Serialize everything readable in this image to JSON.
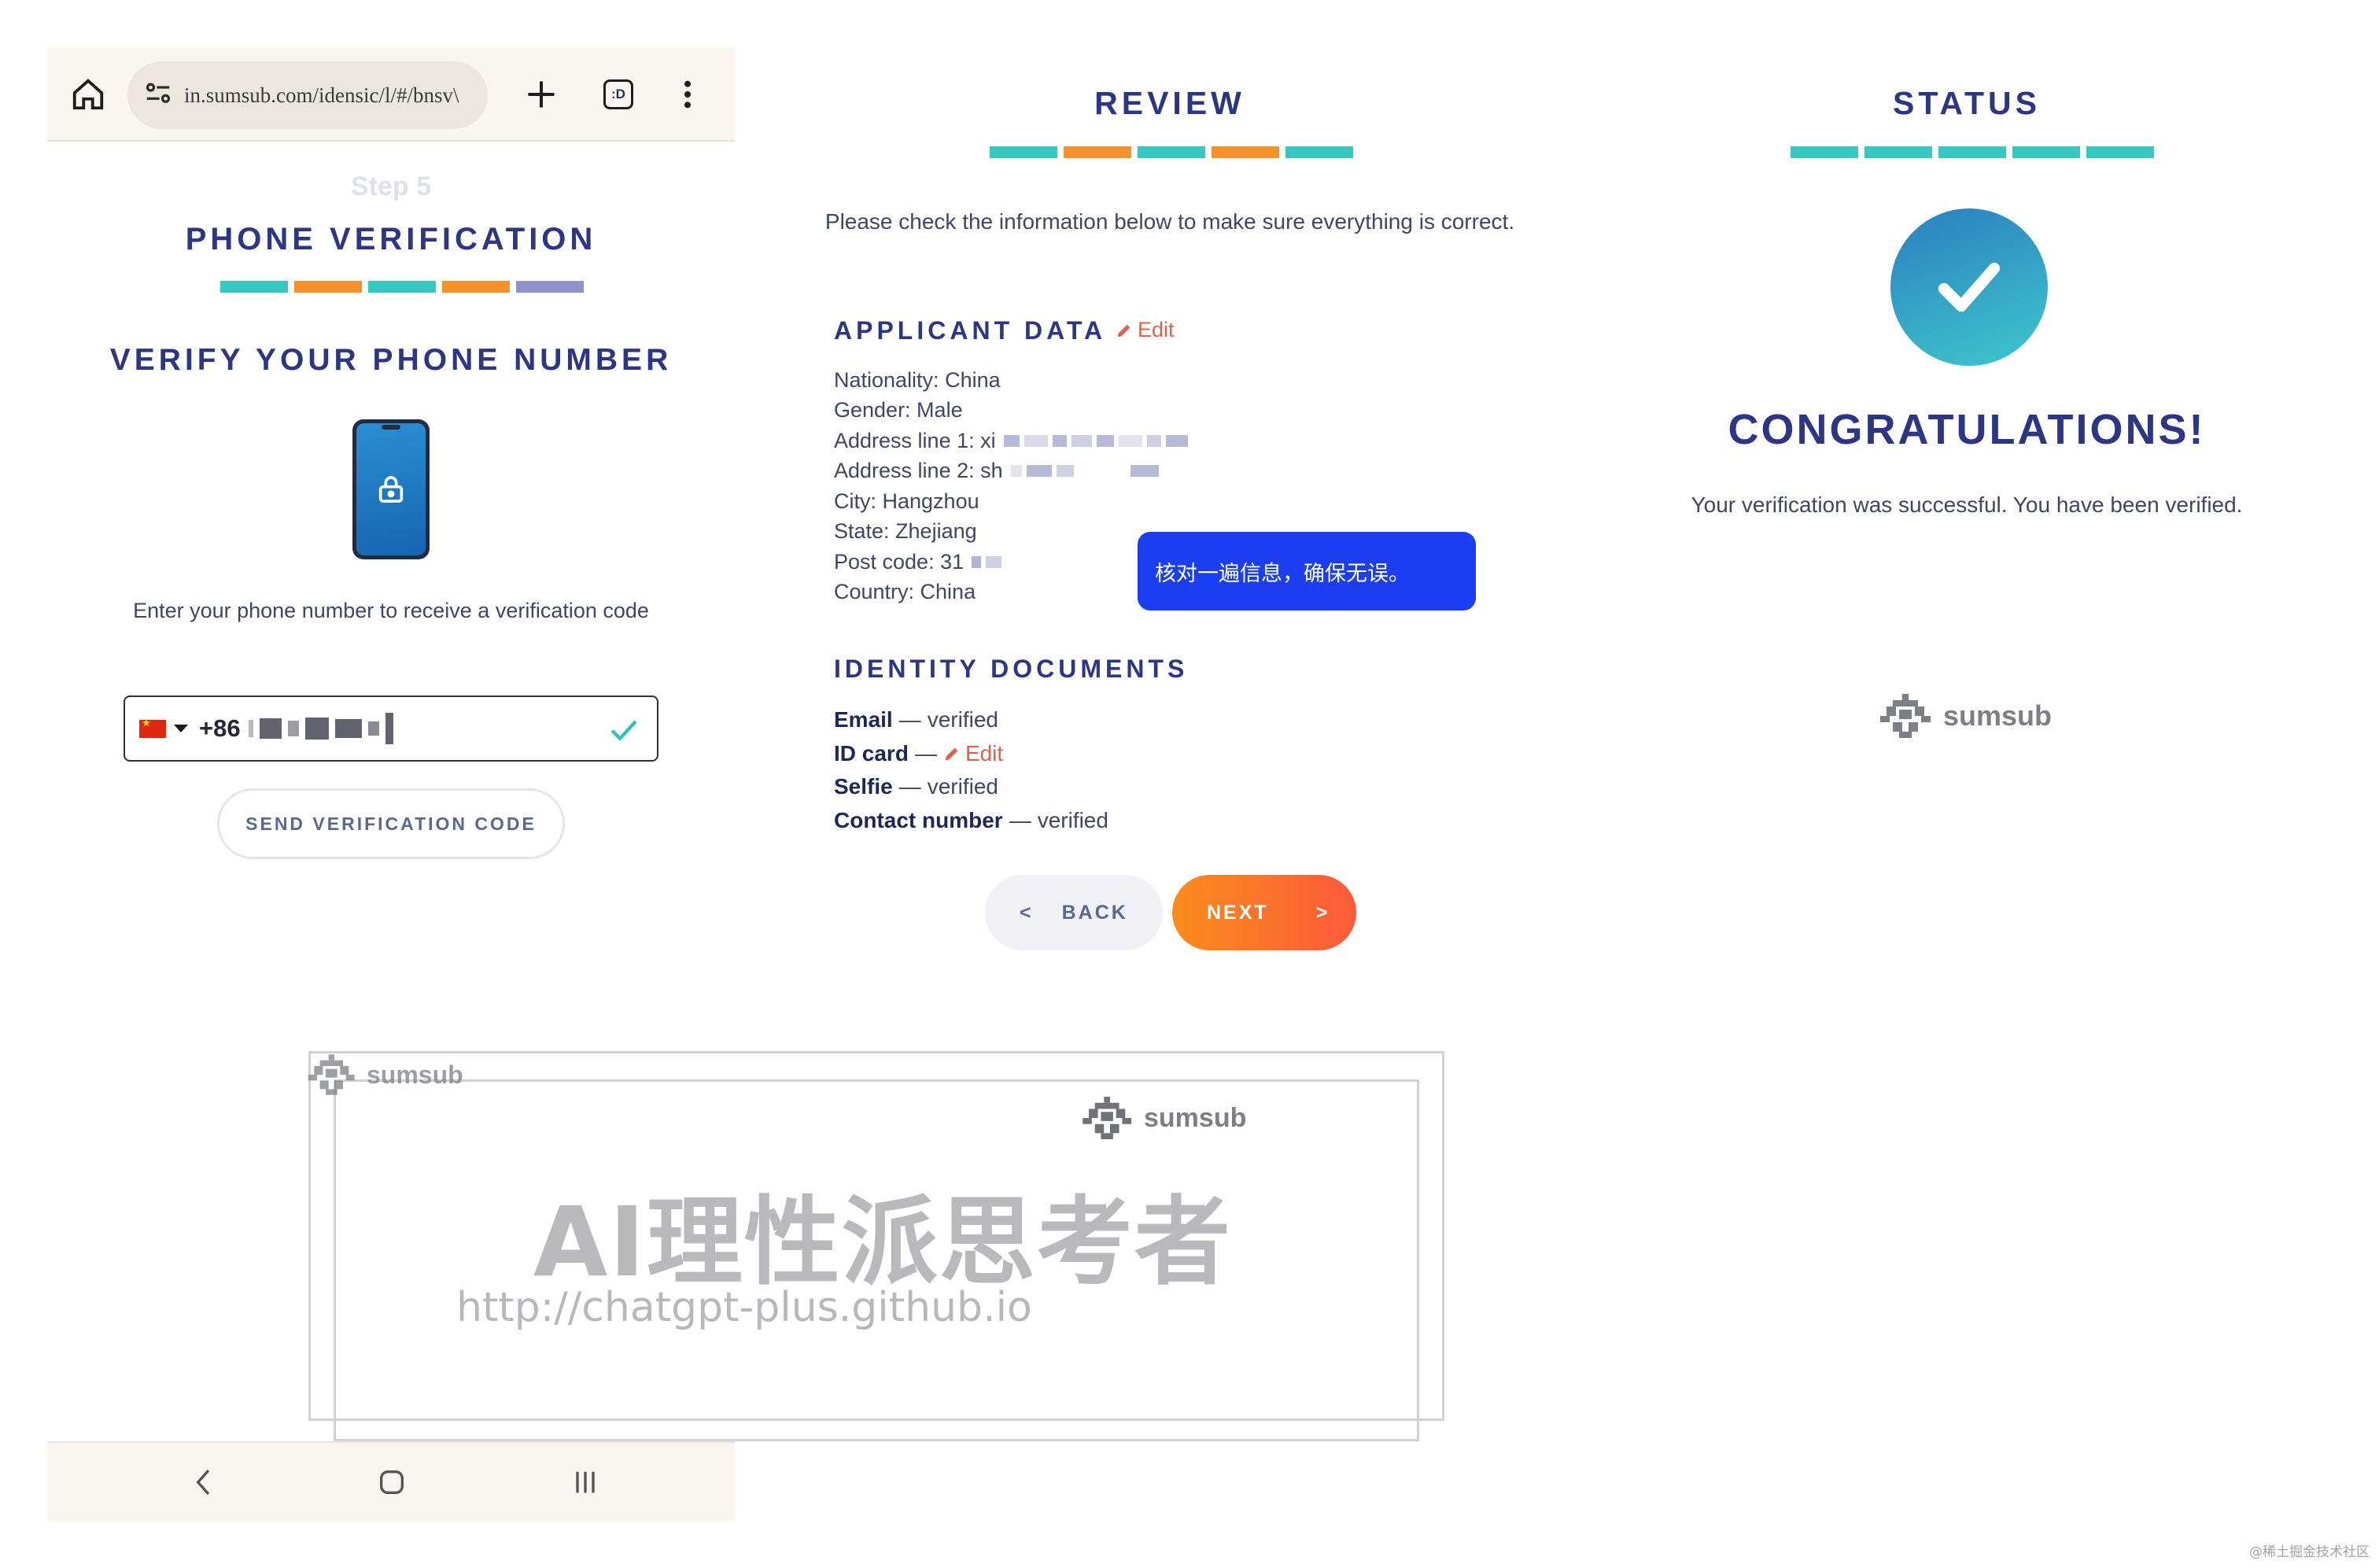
{
  "browser": {
    "url": "in.sumsub.com/idensic/l/#/bnsv\\",
    "tab_count": ":D"
  },
  "left_panel": {
    "step_label": "Step 5",
    "title": "PHONE VERIFICATION",
    "progress_colors": [
      "#36c8c0",
      "#f7922b",
      "#36c8c0",
      "#f7922b",
      "#8f92cc"
    ],
    "subtitle": "VERIFY YOUR PHONE NUMBER",
    "description": "Enter your phone number to receive a verification code",
    "phone_input": {
      "country_flag": "cn-flag",
      "dial_code": "+86",
      "validated": true
    },
    "send_button": "SEND VERIFICATION CODE"
  },
  "review": {
    "title": "REVIEW",
    "progress_colors": [
      "#36c8c0",
      "#f7922b",
      "#36c8c0",
      "#f7922b",
      "#36c8c0"
    ],
    "description": "Please check the information below to make sure everything is correct.",
    "applicant_title": "APPLICANT DATA",
    "edit_label": "Edit",
    "applicant_fields": [
      "Nationality: China",
      "Gender: Male",
      "Address line 1: xi",
      "Address line 2: sh",
      "City: Hangzhou",
      "State: Zhejiang",
      "Post code: 31",
      "Country: China"
    ],
    "tooltip": "核对一遍信息，确保无误。",
    "documents_title": "IDENTITY DOCUMENTS",
    "documents": [
      {
        "name": "Email",
        "sep": "—",
        "status": "verified"
      },
      {
        "name": "ID card",
        "sep": "—",
        "status": "Edit"
      },
      {
        "name": "Selfie",
        "sep": "—",
        "status": "verified"
      },
      {
        "name": "Contact number",
        "sep": "—",
        "status": "verified"
      }
    ],
    "back_label": "BACK",
    "back_arrow": "<",
    "next_label": "NEXT",
    "next_arrow": ">"
  },
  "status": {
    "title": "STATUS",
    "progress_colors": [
      "#36c8c0",
      "#36c8c0",
      "#36c8c0",
      "#36c8c0",
      "#36c8c0"
    ],
    "headline": "CONGRATULATIONS!",
    "message": "Your verification was successful. You have been verified.",
    "brand": "sumsub"
  },
  "watermark": {
    "brand_small": "sumsub",
    "brand_large": "sumsub",
    "title": "AI理性派思考者",
    "url": "http://chatgpt-plus.github.io"
  },
  "credit": "@稀土掘金技术社区"
}
